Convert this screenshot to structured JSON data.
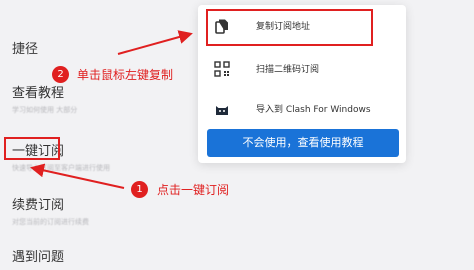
{
  "sidebar": {
    "section_title": "捷径",
    "items": [
      {
        "title": "查看教程",
        "desc": "学习如何使用 大部分"
      },
      {
        "title": "一键订阅",
        "desc": "快速导入订阅至客户端进行使用"
      },
      {
        "title": "续费订阅",
        "desc": "对您当前的订阅进行续费"
      },
      {
        "title": "遇到问题",
        "desc": ""
      }
    ]
  },
  "popup": {
    "items": [
      {
        "label": "复制订阅地址",
        "icon": "copy-icon"
      },
      {
        "label": "扫描二维码订阅",
        "icon": "qr-code-icon"
      },
      {
        "label": "导入到 Clash For Windows",
        "icon": "cat-icon"
      }
    ],
    "button_label": "不会使用，查看使用教程"
  },
  "annotations": {
    "step1": {
      "number": "1",
      "text": "点击一键订阅"
    },
    "step2": {
      "number": "2",
      "text": "单击鼠标左键复制"
    },
    "color": "#e02020"
  },
  "colors": {
    "accent": "#1a73d8",
    "annotation": "#e02020",
    "background": "#f2f2f4"
  }
}
